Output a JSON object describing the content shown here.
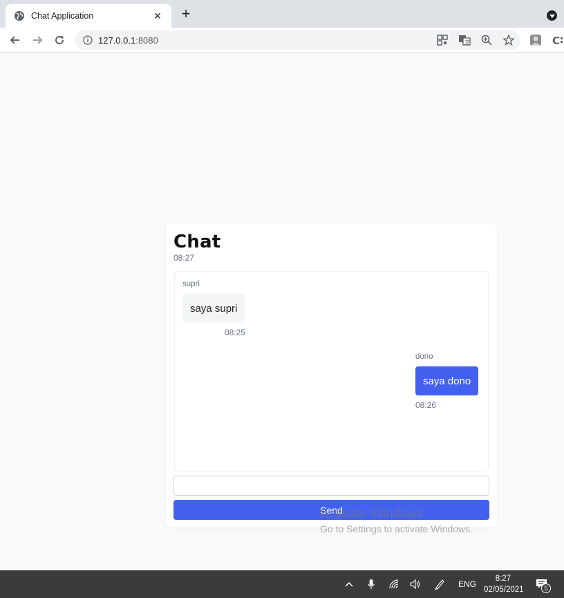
{
  "browser": {
    "tab_title": "Chat Application",
    "url_host": "127.0.0.1",
    "url_port": ":8080"
  },
  "chat": {
    "title": "Chat",
    "time": "08:27",
    "messages": [
      {
        "sender": "supri",
        "text": "saya supri",
        "time": "08:25",
        "direction": "incoming"
      },
      {
        "sender": "dono",
        "text": "saya dono",
        "time": "08:26",
        "direction": "outgoing"
      }
    ],
    "input_value": "",
    "send_label": "Send"
  },
  "watermark": {
    "line1": "Activate Windows",
    "line2": "Go to Settings to activate Windows."
  },
  "taskbar": {
    "language": "ENG",
    "time": "8:27",
    "date": "02/05/2021",
    "notification_count": "5"
  },
  "colors": {
    "accent": "#4361ee",
    "page_bg": "#f8f9fb",
    "taskbar_bg": "#3b3b3b"
  }
}
